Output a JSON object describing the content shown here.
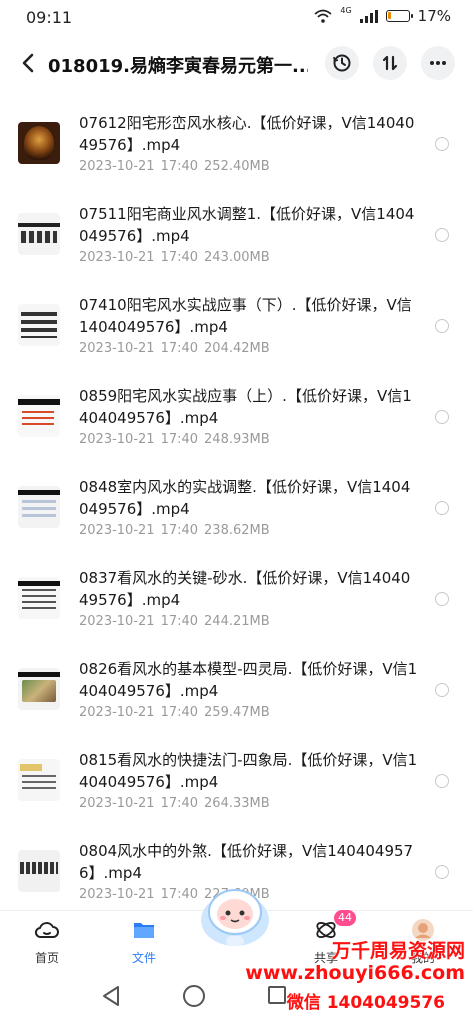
{
  "status_bar": {
    "time": "09:11",
    "network_tag": "4G",
    "battery_percent": "17%",
    "battery_level": 0.17,
    "battery_color": "#f08a00"
  },
  "header": {
    "back_icon": "chevron-left-icon",
    "title": "018019.易熵李寅春易元第一...",
    "history_icon": "history-icon",
    "sort_icon": "sort-icon",
    "more_icon": "more-horizontal-icon"
  },
  "files": [
    {
      "name": "07612阳宅形峦风水核心.【低价好课，V信1404049576】.mp4",
      "date": "2023-10-21",
      "time": "17:40",
      "size": "252.40MB"
    },
    {
      "name": "07511阳宅商业风水调整1.【低价好课，V信1404049576】.mp4",
      "date": "2023-10-21",
      "time": "17:40",
      "size": "243.00MB"
    },
    {
      "name": "07410阳宅风水实战应事（下）.【低价好课，V信1404049576】.mp4",
      "date": "2023-10-21",
      "time": "17:40",
      "size": "204.42MB"
    },
    {
      "name": "0859阳宅风水实战应事（上）.【低价好课，V信1404049576】.mp4",
      "date": "2023-10-21",
      "time": "17:40",
      "size": "248.93MB"
    },
    {
      "name": "0848室内风水的实战调整.【低价好课，V信1404049576】.mp4",
      "date": "2023-10-21",
      "time": "17:40",
      "size": "238.62MB"
    },
    {
      "name": "0837看风水的关键-砂水.【低价好课，V信1404049576】.mp4",
      "date": "2023-10-21",
      "time": "17:40",
      "size": "244.21MB"
    },
    {
      "name": "0826看风水的基本模型-四灵局.【低价好课，V信1404049576】.mp4",
      "date": "2023-10-21",
      "time": "17:40",
      "size": "259.47MB"
    },
    {
      "name": "0815看风水的快捷法门-四象局.【低价好课，V信1404049576】.mp4",
      "date": "2023-10-21",
      "time": "17:40",
      "size": "264.33MB"
    },
    {
      "name": "0804风水中的外煞.【低价好课，V信1404049576】.mp4",
      "date": "2023-10-21",
      "time": "17:40",
      "size": "227.60MB"
    }
  ],
  "tabs": {
    "home": "首页",
    "files": "文件",
    "share": "共享",
    "mine": "我的",
    "share_badge": "44",
    "active_color": "#2c7cf6"
  },
  "watermark": {
    "line1": "万千周易资源网",
    "line2": "www.zhouyi666.com",
    "line3": "微信 1404049576",
    "color": "#ff1010"
  }
}
